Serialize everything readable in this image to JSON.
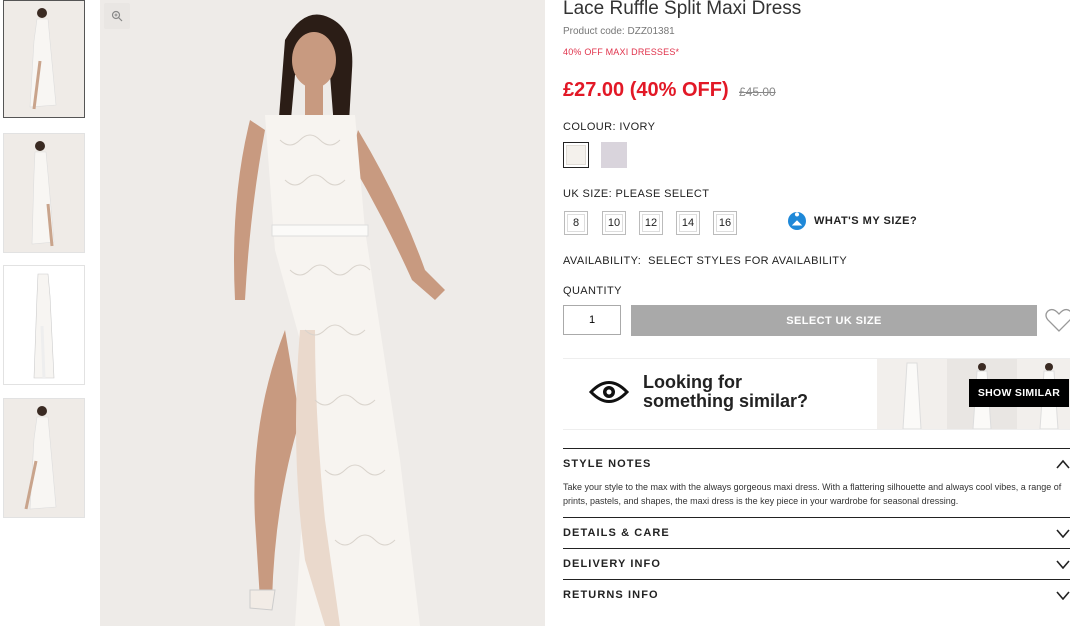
{
  "product": {
    "title": "Lace Ruffle Split Maxi Dress",
    "code": "Product code: DZZ01381",
    "promo": "40% OFF MAXI DRESSES*",
    "price": "£27.00 (40% OFF)",
    "old_price": "£45.00"
  },
  "colour": {
    "label": "COLOUR:",
    "value": "IVORY",
    "swatches": [
      "#f4f1ec",
      "#d9d4dc"
    ]
  },
  "size": {
    "label": "UK SIZE:",
    "value": "PLEASE SELECT",
    "options": [
      "8",
      "10",
      "12",
      "14",
      "16"
    ],
    "help": "WHAT'S MY SIZE?"
  },
  "availability": {
    "label": "AVAILABILITY:",
    "value": "SELECT STYLES FOR AVAILABILITY"
  },
  "quantity": {
    "label": "QUANTITY",
    "value": "1"
  },
  "add_button": "SELECT UK SIZE",
  "similar": {
    "line1": "Looking for",
    "line2": "something similar?",
    "button": "SHOW SIMILAR"
  },
  "accordion": {
    "style_notes": "STYLE NOTES",
    "style_notes_text": "Take your style to the max with the always gorgeous maxi dress. With a flattering silhouette and always cool vibes, a range of prints, pastels, and shapes, the maxi dress is the key piece in your wardrobe for seasonal dressing.",
    "details": "DETAILS & CARE",
    "delivery": "DELIVERY INFO",
    "returns": "RETURNS INFO"
  },
  "colors": {
    "sale_red": "#e21826",
    "promo_pink": "#e0324b",
    "button_grey": "#a9a9a9",
    "help_blue": "#1e88d8"
  }
}
